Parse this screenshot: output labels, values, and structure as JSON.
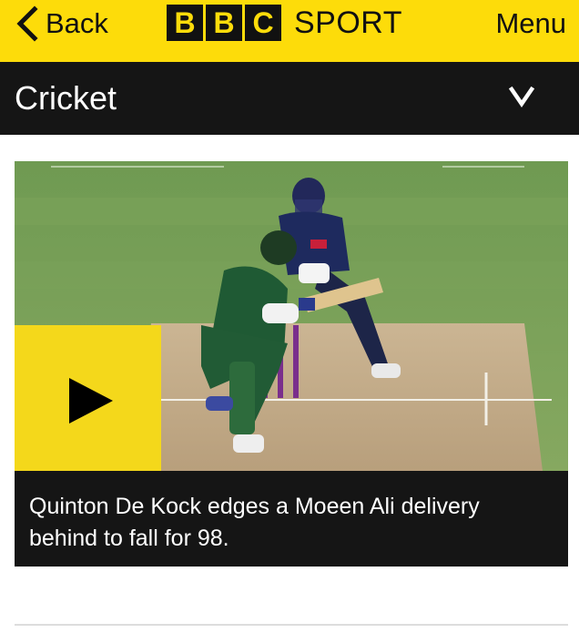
{
  "header": {
    "back_label": "Back",
    "logo_letters": [
      "B",
      "B",
      "C"
    ],
    "logo_word": "SPORT",
    "menu_label": "Menu",
    "brand_yellow": "#fddc0a"
  },
  "section": {
    "title": "Cricket",
    "toggle_icon": "chevron-down-icon"
  },
  "video_card": {
    "caption": "Quinton De Kock edges a Moeen Ali delivery behind to fall for 98.",
    "play_icon": "play-icon",
    "play_button_color": "#f4d81b"
  }
}
